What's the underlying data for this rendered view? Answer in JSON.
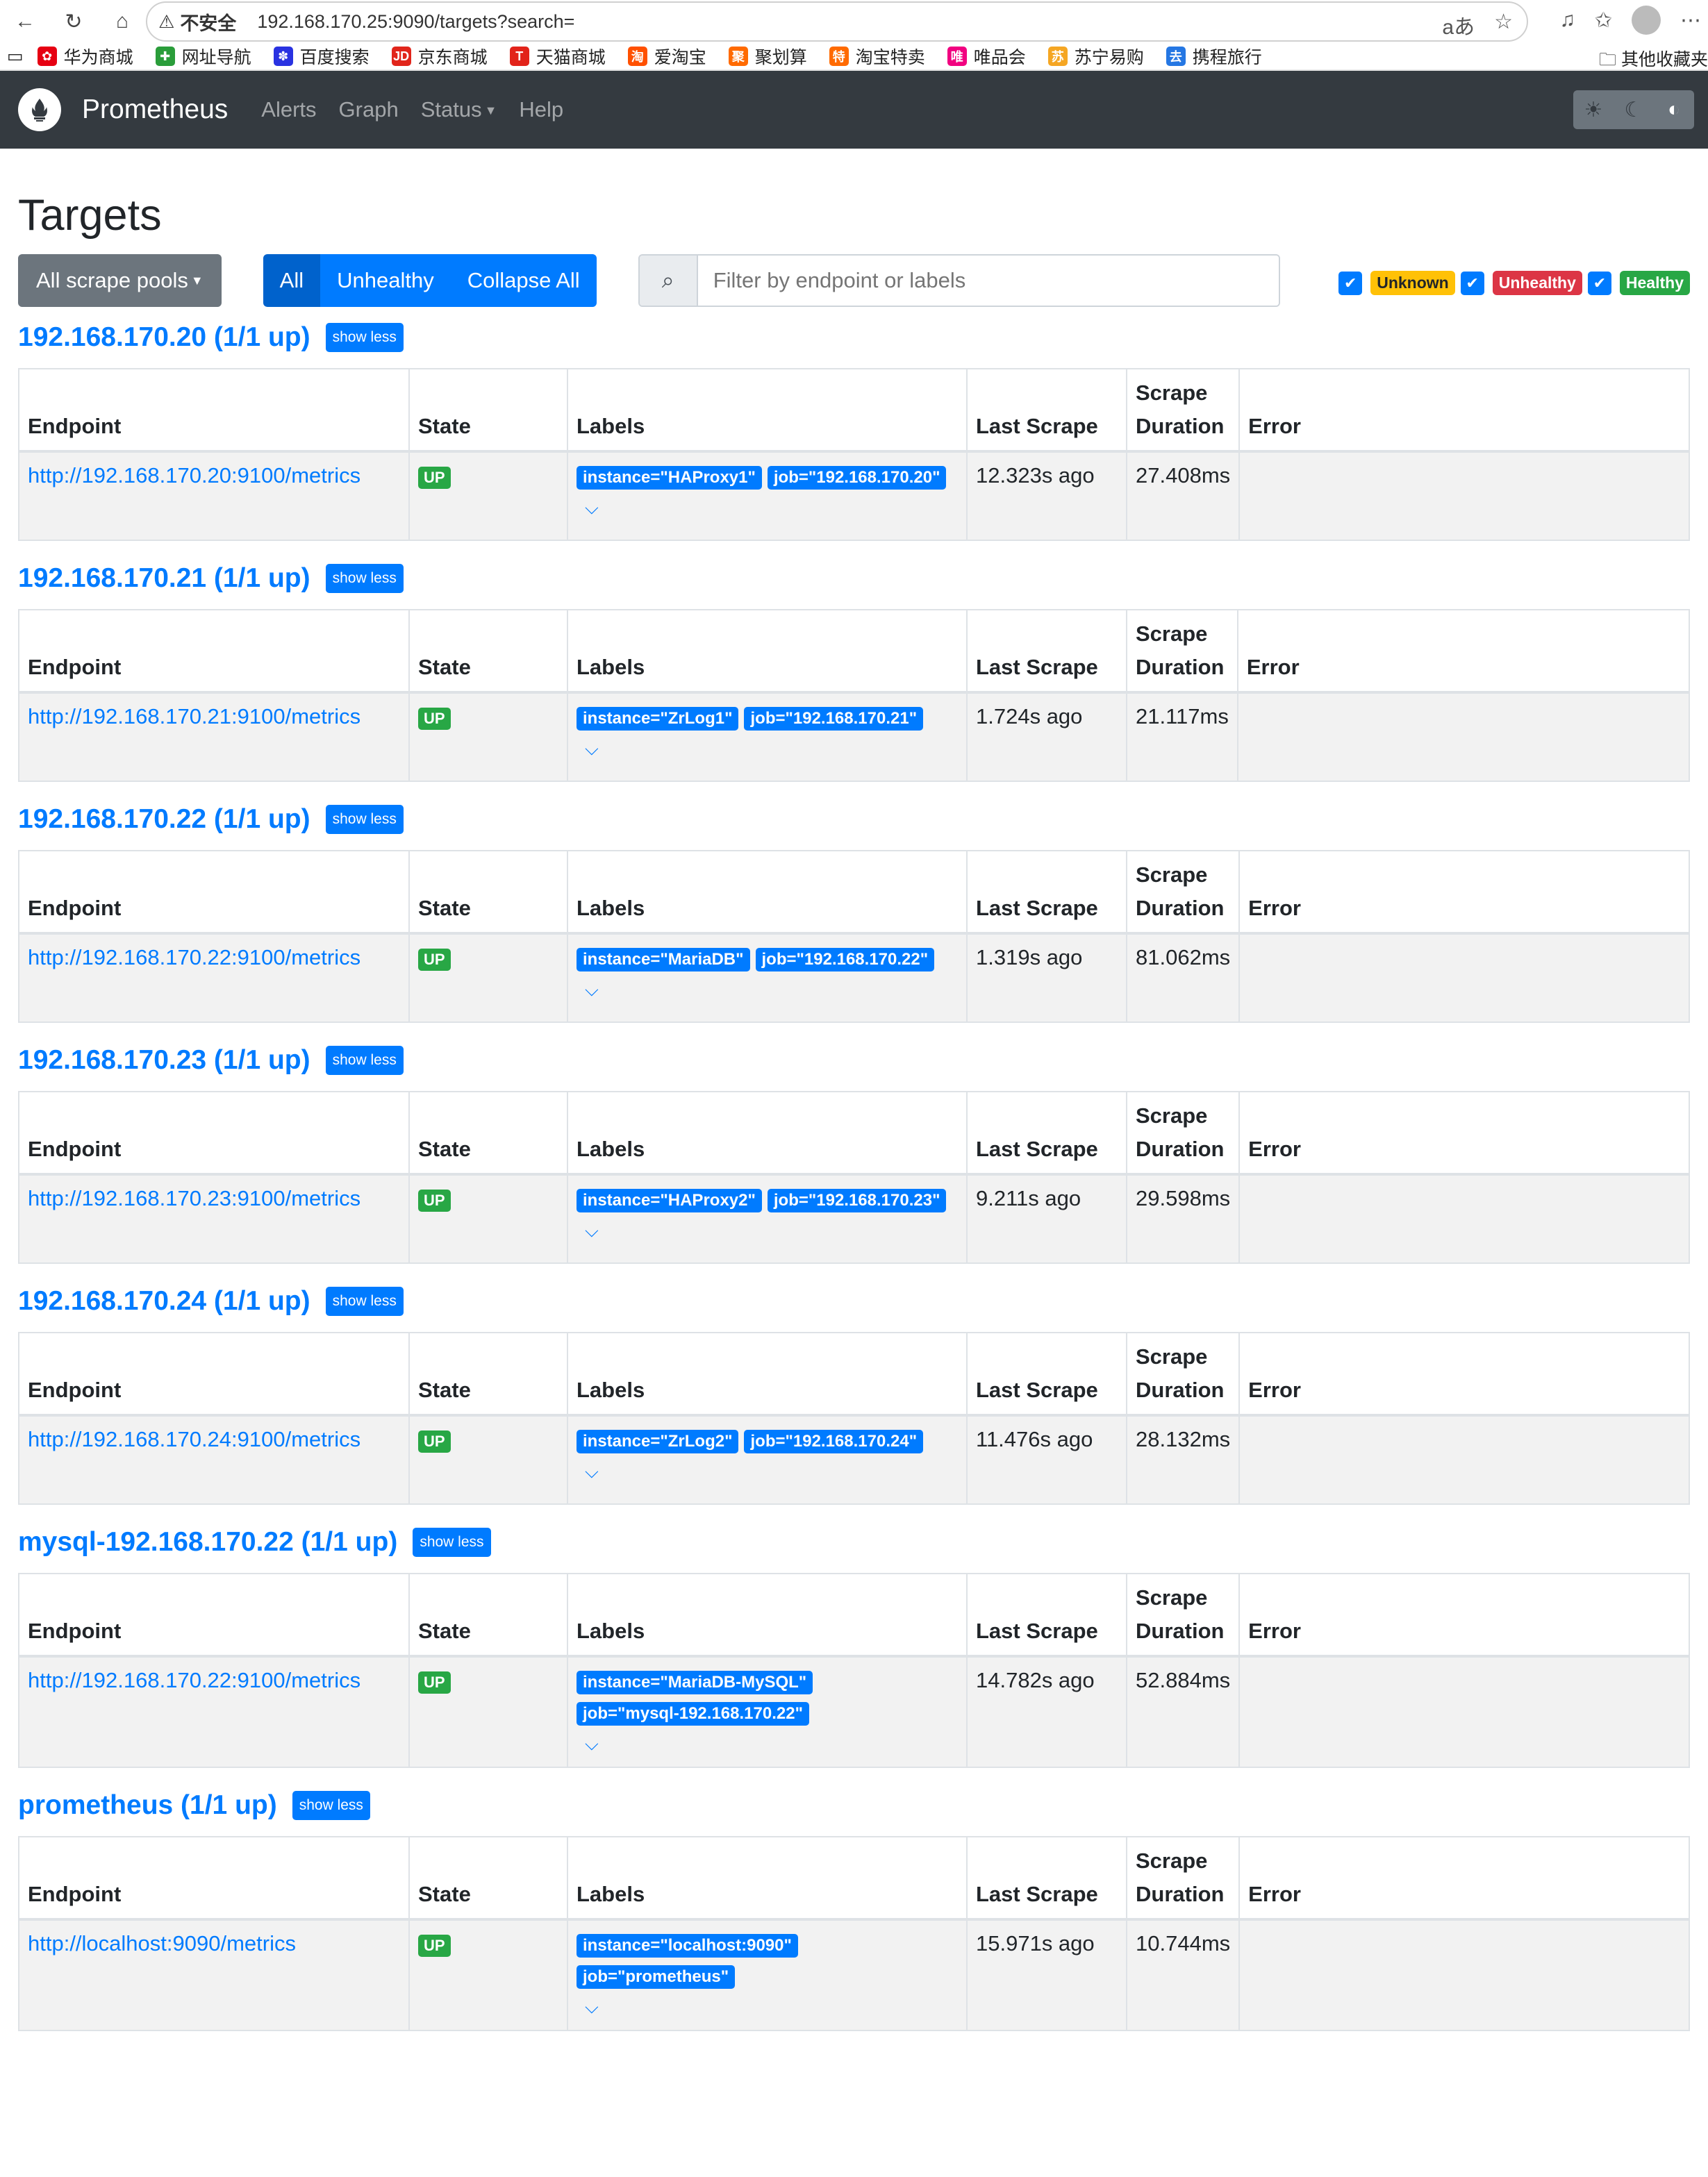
{
  "browser": {
    "insecure_label": "不安全",
    "url": "192.168.170.25:9090/targets?search=",
    "bookmarks": [
      {
        "label": "华为商城",
        "color": "#e60012",
        "glyph": "✿"
      },
      {
        "label": "网址导航",
        "color": "#2a9d3a",
        "glyph": "✚"
      },
      {
        "label": "百度搜索",
        "color": "#2932e1",
        "glyph": "✽"
      },
      {
        "label": "京东商城",
        "color": "#e1251b",
        "glyph": "JD"
      },
      {
        "label": "天猫商城",
        "color": "#e2231a",
        "glyph": "T"
      },
      {
        "label": "爱淘宝",
        "color": "#ff5000",
        "glyph": "淘"
      },
      {
        "label": "聚划算",
        "color": "#ff6a00",
        "glyph": "聚"
      },
      {
        "label": "淘宝特卖",
        "color": "#ff6a00",
        "glyph": "特"
      },
      {
        "label": "唯品会",
        "color": "#f10180",
        "glyph": "唯"
      },
      {
        "label": "苏宁易购",
        "color": "#f5a623",
        "glyph": "苏"
      },
      {
        "label": "携程旅行",
        "color": "#2577e3",
        "glyph": "去"
      }
    ],
    "other_bookmarks": "其他收藏夹"
  },
  "navbar": {
    "brand": "Prometheus",
    "links": {
      "alerts": "Alerts",
      "graph": "Graph",
      "status": "Status",
      "help": "Help"
    }
  },
  "page": {
    "title": "Targets",
    "pools_dropdown": "All scrape pools",
    "filter_all": "All",
    "filter_unhealthy": "Unhealthy",
    "collapse_all": "Collapse All",
    "search_placeholder": "Filter by endpoint or labels",
    "health_filters": {
      "unknown": "Unknown",
      "unhealthy": "Unhealthy",
      "healthy": "Healthy"
    }
  },
  "table_headers": {
    "endpoint": "Endpoint",
    "state": "State",
    "labels": "Labels",
    "last_scrape": "Last Scrape",
    "scrape_duration_1": "Scrape",
    "scrape_duration_2": "Duration",
    "error": "Error"
  },
  "show_less_label": "show less",
  "pools": [
    {
      "title": "192.168.170.20 (1/1 up)",
      "endpoint": "http://192.168.170.20:9100/metrics",
      "state": "UP",
      "labels": [
        "instance=\"HAProxy1\"",
        "job=\"192.168.170.20\""
      ],
      "last_scrape": "12.323s ago",
      "duration": "27.408ms",
      "error": ""
    },
    {
      "title": "192.168.170.21 (1/1 up)",
      "endpoint": "http://192.168.170.21:9100/metrics",
      "state": "UP",
      "labels": [
        "instance=\"ZrLog1\"",
        "job=\"192.168.170.21\""
      ],
      "last_scrape": "1.724s ago",
      "duration": "21.117ms",
      "error": ""
    },
    {
      "title": "192.168.170.22 (1/1 up)",
      "endpoint": "http://192.168.170.22:9100/metrics",
      "state": "UP",
      "labels": [
        "instance=\"MariaDB\"",
        "job=\"192.168.170.22\""
      ],
      "last_scrape": "1.319s ago",
      "duration": "81.062ms",
      "error": ""
    },
    {
      "title": "192.168.170.23 (1/1 up)",
      "endpoint": "http://192.168.170.23:9100/metrics",
      "state": "UP",
      "labels": [
        "instance=\"HAProxy2\"",
        "job=\"192.168.170.23\""
      ],
      "last_scrape": "9.211s ago",
      "duration": "29.598ms",
      "error": ""
    },
    {
      "title": "192.168.170.24 (1/1 up)",
      "endpoint": "http://192.168.170.24:9100/metrics",
      "state": "UP",
      "labels": [
        "instance=\"ZrLog2\"",
        "job=\"192.168.170.24\""
      ],
      "last_scrape": "11.476s ago",
      "duration": "28.132ms",
      "error": ""
    },
    {
      "title": "mysql-192.168.170.22 (1/1 up)",
      "endpoint": "http://192.168.170.22:9100/metrics",
      "state": "UP",
      "labels": [
        "instance=\"MariaDB-MySQL\"",
        "job=\"mysql-192.168.170.22\""
      ],
      "last_scrape": "14.782s ago",
      "duration": "52.884ms",
      "error": ""
    },
    {
      "title": "prometheus (1/1 up)",
      "endpoint": "http://localhost:9090/metrics",
      "state": "UP",
      "labels": [
        "instance=\"localhost:9090\"",
        "job=\"prometheus\""
      ],
      "last_scrape": "15.971s ago",
      "duration": "10.744ms",
      "error": ""
    }
  ]
}
